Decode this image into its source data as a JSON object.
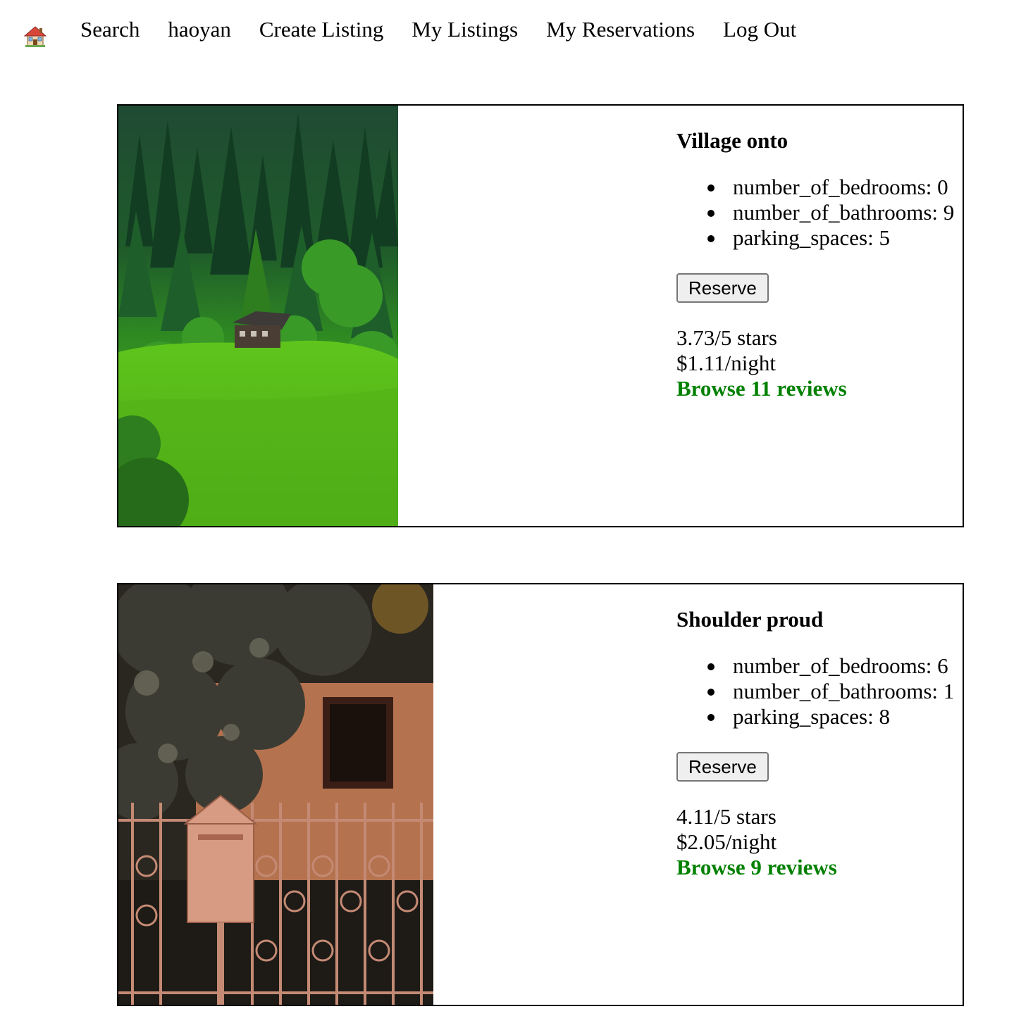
{
  "nav": {
    "home_icon": "house-icon",
    "links": [
      "Search",
      "haoyan",
      "Create Listing",
      "My Listings",
      "My Reservations",
      "Log Out"
    ]
  },
  "listings": [
    {
      "title": "Village onto",
      "features": [
        "number_of_bedrooms: 0",
        "number_of_bathrooms: 9",
        "parking_spaces: 5"
      ],
      "reserve_label": "Reserve",
      "rating": "3.73/5 stars",
      "price": "$1.11/night",
      "reviews_link": "Browse 11 reviews",
      "image": "forest-hillside-cabin-photo"
    },
    {
      "title": "Shoulder proud",
      "features": [
        "number_of_bedrooms: 6",
        "number_of_bathrooms: 1",
        "parking_spaces: 8"
      ],
      "reserve_label": "Reserve",
      "rating": "4.11/5 stars",
      "price": "$2.05/night",
      "reviews_link": "Browse 9 reviews",
      "image": "mailbox-ironwork-fence-photo"
    }
  ],
  "colors": {
    "link_green": "#008000",
    "border": "#000000"
  }
}
